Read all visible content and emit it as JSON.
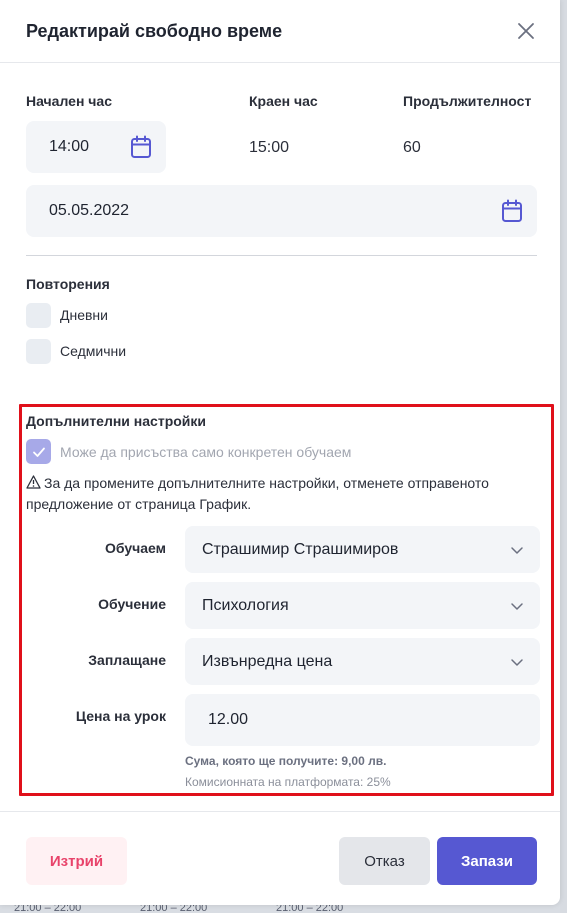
{
  "modal": {
    "title": "Редактирай свободно време"
  },
  "time": {
    "start_label": "Начален час",
    "start_value": "14:00",
    "end_label": "Краен час",
    "end_value": "15:00",
    "duration_label": "Продължителност",
    "duration_value": "60"
  },
  "date": {
    "value": "05.05.2022"
  },
  "repeats": {
    "title": "Повторения",
    "daily": "Дневни",
    "weekly": "Седмични"
  },
  "extra": {
    "title": "Допълнителни настройки",
    "only_student": "Може да присъства само конкретен обучаем",
    "warning": "За да промените допълнителните настройки, отменете отправеното предложение от страница График.",
    "student_label": "Обучаем",
    "student_value": "Страшимир Страшимиров",
    "course_label": "Обучение",
    "course_value": "Психология",
    "payment_label": "Заплащане",
    "payment_value": "Извънредна цена",
    "price_label": "Цена на урок",
    "price_value": "12.00",
    "sum_text": "Сума, която ще получите: 9,00 лв.",
    "commission_text": "Комисионната на платформата: 25%"
  },
  "footer": {
    "delete": "Изтрий",
    "cancel": "Отказ",
    "save": "Запази"
  },
  "backdrop": {
    "times": [
      "21:00 – 22:00",
      "21:00 – 22:00",
      "21:00 – 22:00"
    ]
  },
  "colors": {
    "accent": "#5658d2",
    "danger": "#e8436a",
    "highlight_border": "#e0101a"
  }
}
